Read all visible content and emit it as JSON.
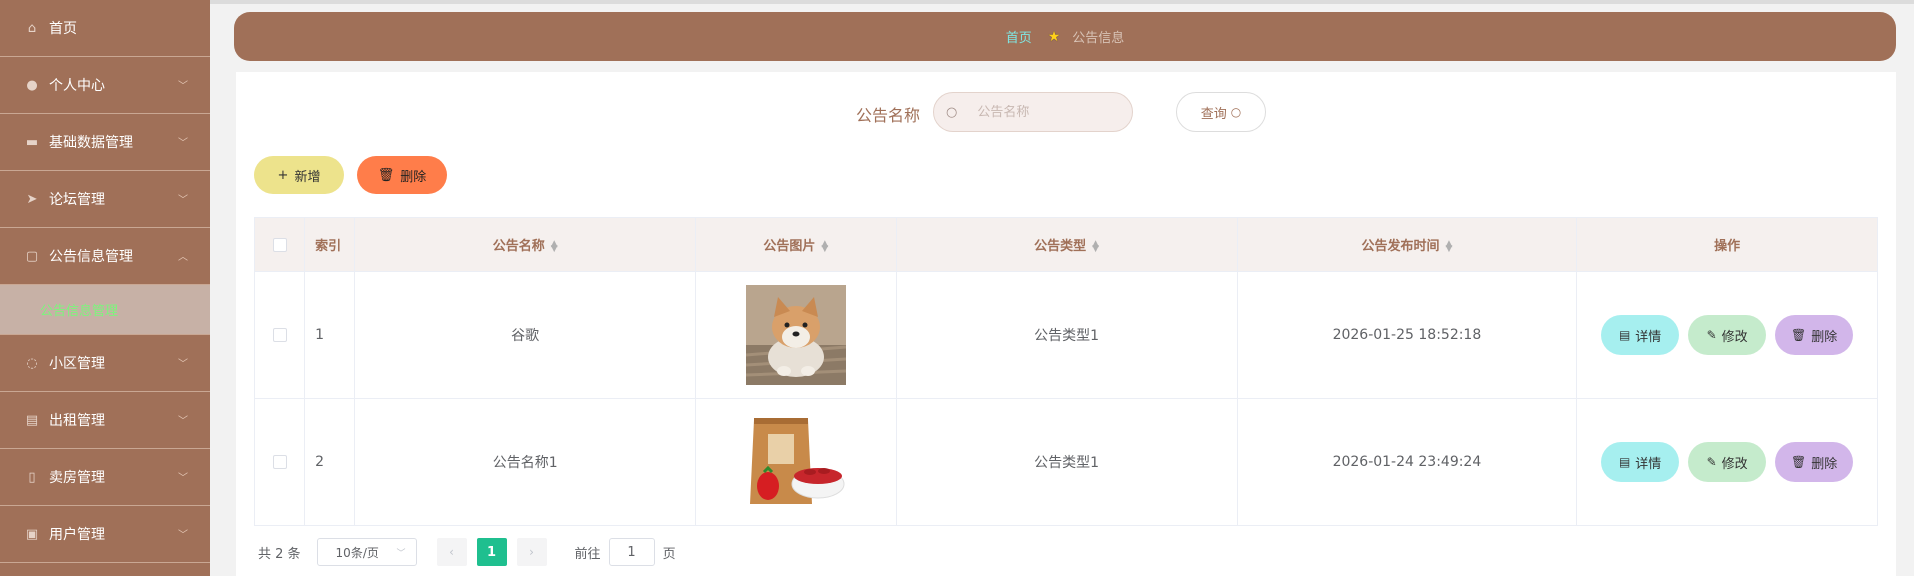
{
  "sidebar": {
    "items": [
      {
        "label": "首页",
        "icon": "home-icon",
        "glyph": "⌂",
        "has_chevron": false
      },
      {
        "label": "个人中心",
        "icon": "user-icon",
        "glyph": "●",
        "has_chevron": true
      },
      {
        "label": "基础数据管理",
        "icon": "monitor-icon",
        "glyph": "▬",
        "has_chevron": true
      },
      {
        "label": "论坛管理",
        "icon": "send-icon",
        "glyph": "➤",
        "has_chevron": true
      },
      {
        "label": "公告信息管理",
        "icon": "chat-icon",
        "glyph": "▢",
        "has_chevron": true,
        "expanded": true
      },
      {
        "label": "小区管理",
        "icon": "loading-icon",
        "glyph": "◌",
        "has_chevron": true
      },
      {
        "label": "出租管理",
        "icon": "briefcase-icon",
        "glyph": "▤",
        "has_chevron": true
      },
      {
        "label": "卖房管理",
        "icon": "mobile-icon",
        "glyph": "▯",
        "has_chevron": true
      },
      {
        "label": "用户管理",
        "icon": "document-icon",
        "glyph": "▣",
        "has_chevron": true
      }
    ],
    "sub_item": "公告信息管理"
  },
  "breadcrumb": {
    "home": "首页",
    "current": "公告信息"
  },
  "search": {
    "label": "公告名称",
    "placeholder": "公告名称",
    "button": "查询"
  },
  "actions": {
    "add": "新增",
    "delete": "删除"
  },
  "table": {
    "columns": {
      "index": "索引",
      "name": "公告名称",
      "image": "公告图片",
      "type": "公告类型",
      "time": "公告发布时间",
      "ops": "操作"
    },
    "rows": [
      {
        "index": "1",
        "name": "谷歌",
        "image": "shiba-dog-photo",
        "type": "公告类型1",
        "time": "2026-01-25 18:52:18"
      },
      {
        "index": "2",
        "name": "公告名称1",
        "image": "goji-berry-bag-photo",
        "type": "公告类型1",
        "time": "2026-01-24 23:49:24"
      }
    ],
    "row_actions": {
      "detail": "详情",
      "edit": "修改",
      "delete": "删除"
    }
  },
  "pagination": {
    "total": "共 2 条",
    "page_size": "10条/页",
    "current_page": "1",
    "goto_prefix": "前往",
    "goto_value": "1",
    "goto_suffix": "页"
  },
  "colors": {
    "sidebar_bg": "#a07058",
    "active_sub_text": "#7cf57c",
    "pager_active": "#1fbf8f",
    "add_btn": "#ede38c",
    "delete_btn": "#ff7d4a"
  }
}
